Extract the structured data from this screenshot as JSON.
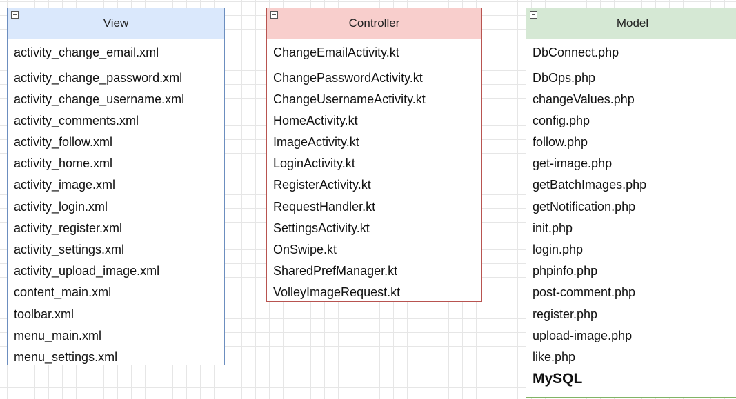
{
  "boxes": {
    "view": {
      "title": "View",
      "items": [
        "activity_change_email.xml",
        "activity_change_password.xml",
        "activity_change_username.xml",
        "activity_comments.xml",
        "activity_follow.xml",
        "activity_home.xml",
        "activity_image.xml",
        "activity_login.xml",
        "activity_register.xml",
        "activity_settings.xml",
        "activity_upload_image.xml",
        "content_main.xml",
        "toolbar.xml",
        "menu_main.xml",
        "menu_settings.xml"
      ]
    },
    "controller": {
      "title": "Controller",
      "items": [
        "ChangeEmailActivity.kt",
        "ChangePasswordActivity.kt",
        "ChangeUsernameActivity.kt",
        "HomeActivity.kt",
        "ImageActivity.kt",
        "LoginActivity.kt",
        "RegisterActivity.kt",
        "RequestHandler.kt",
        "SettingsActivity.kt",
        "OnSwipe.kt",
        "SharedPrefManager.kt",
        "VolleyImageRequest.kt"
      ]
    },
    "model": {
      "title": "Model",
      "items": [
        "DbConnect.php",
        "DbOps.php",
        "changeValues.php",
        "config.php",
        "follow.php",
        "get-image.php",
        "getBatchImages.php",
        "getNotification.php",
        "init.php",
        "login.php",
        "phpinfo.php",
        "post-comment.php",
        "register.php",
        "upload-image.php",
        "like.php"
      ],
      "footer": "MySQL"
    }
  },
  "colors": {
    "view_fill": "#dae8fc",
    "view_stroke": "#6c8ebf",
    "controller_fill": "#f8cecc",
    "controller_stroke": "#b85450",
    "model_fill": "#d5e8d4",
    "model_stroke": "#82b366"
  }
}
